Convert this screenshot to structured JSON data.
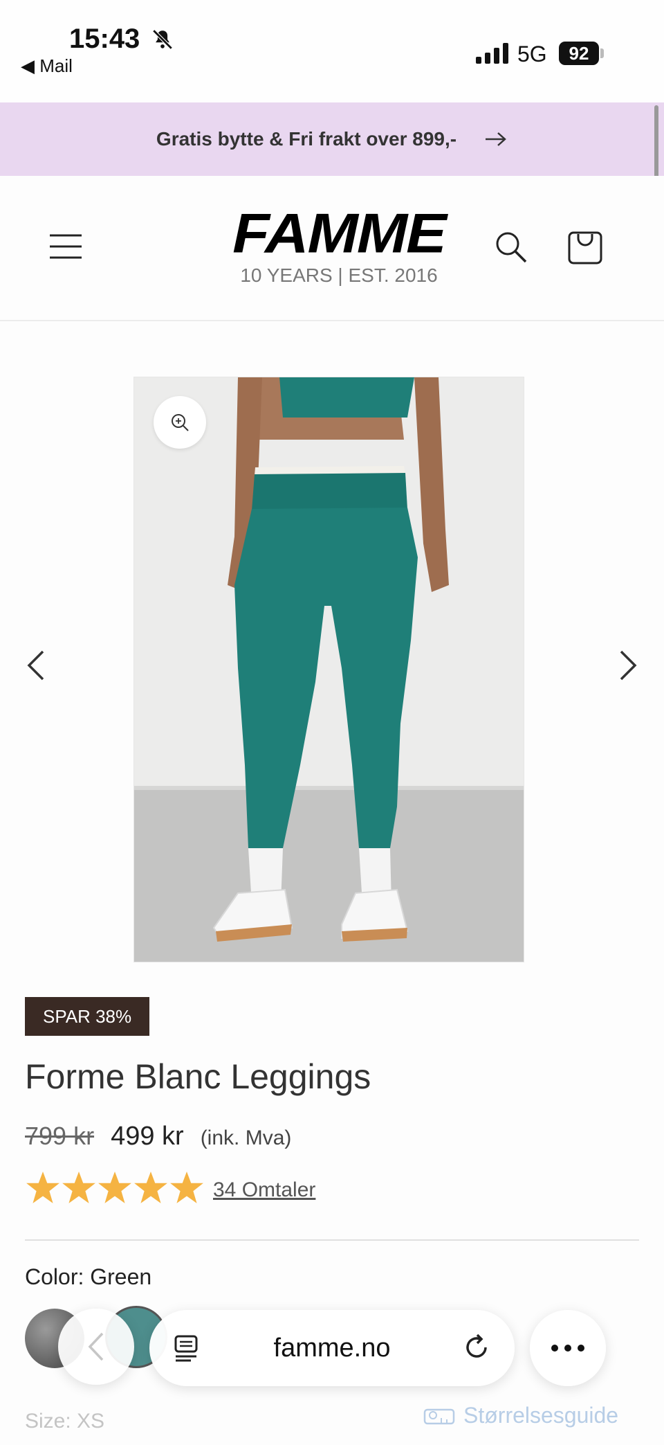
{
  "status_bar": {
    "time": "15:43",
    "back_app": "◀ Mail",
    "network": "5G",
    "battery": "92"
  },
  "promo": {
    "text": "Gratis bytte & Fri frakt over 899,-"
  },
  "header": {
    "logo": "FAMME",
    "tagline": "10 YEARS  |  EST. 2016"
  },
  "product": {
    "badge": "SPAR 38%",
    "title": "Forme Blanc Leggings",
    "old_price": "799 kr",
    "price": "499 kr",
    "vat_note": "(ink. Mva)",
    "rating": 5,
    "reviews_link": "34 Omtaler",
    "color_label": "Color: Green",
    "size_label": "Size: XS",
    "size_guide": "Størrelsesguide",
    "swatches": [
      "Grey",
      "Green"
    ]
  },
  "browser": {
    "url": "famme.no"
  },
  "colors": {
    "promo_bg": "#e9d7f0",
    "badge_bg": "#3a2a24",
    "star": "#f5b342",
    "legging_green": "#1f7f78"
  }
}
